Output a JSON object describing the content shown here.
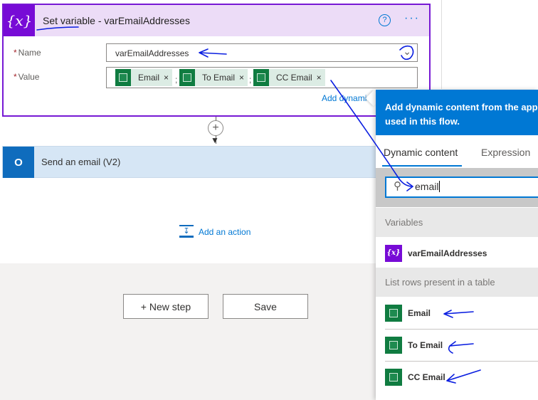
{
  "set_variable": {
    "title": "Set variable - varEmailAddresses",
    "icon": "variable-icon",
    "help_icon": "?",
    "more_icon": "···",
    "name_label": "Name",
    "name_value": "varEmailAddresses",
    "value_label": "Value",
    "required_mark": "*",
    "tokens": [
      {
        "label": "Email"
      },
      {
        "label": "To Email"
      },
      {
        "label": "CC Email"
      }
    ],
    "token_separator": ";",
    "token_remove": "×",
    "add_dynamic_link": "Add dynamic"
  },
  "connector": {
    "plus": "+"
  },
  "send_email": {
    "title": "Send an email (V2)",
    "icon": "outlook-icon",
    "icon_text": "O"
  },
  "add_action": "Add an action",
  "buttons": {
    "new_step": "+ New step",
    "save": "Save"
  },
  "dynamic_panel": {
    "header": "Add dynamic content from the apps and connectors used in this flow.",
    "header_line1": "Add dynamic content from the apps a",
    "header_line2": "used in this flow.",
    "tabs": [
      {
        "label": "Dynamic content",
        "active": true
      },
      {
        "label": "Expression",
        "active": false
      }
    ],
    "search_value": "email",
    "sections": [
      {
        "title": "Variables",
        "items": [
          {
            "label": "varEmailAddresses",
            "icon": "variable-icon"
          }
        ]
      },
      {
        "title": "List rows present in a table",
        "items": [
          {
            "label": "Email",
            "icon": "excel-icon"
          },
          {
            "label": "To Email",
            "icon": "excel-icon"
          },
          {
            "label": "CC Email",
            "icon": "excel-icon"
          }
        ]
      }
    ]
  },
  "colors": {
    "purple": "#770bd6",
    "header_purple": "#ecdcf7",
    "blue": "#0078d4",
    "excel_green": "#107c41",
    "annotation": "#0a1ee0"
  }
}
